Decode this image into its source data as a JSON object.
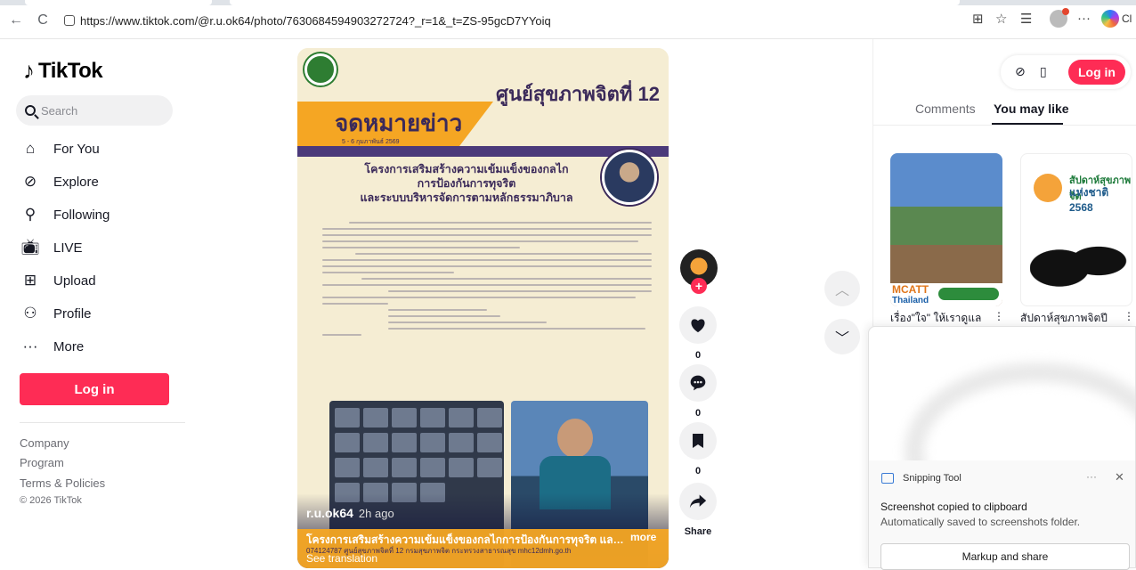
{
  "browser": {
    "back_glyph": "←",
    "reload_glyph": "C",
    "url": "https://www.tiktok.com/@r.u.ok64/photo/7630684594903272724?_r=1&_t=ZS-95gcD7YYoiq",
    "truncated_label": "Cl",
    "icons": [
      "app-grid-icon",
      "favorite-star-icon",
      "favorites-list-icon",
      "profile-icon",
      "more-icon",
      "copilot-icon"
    ]
  },
  "sidebar": {
    "logo_text": "TikTok",
    "search_placeholder": "Search",
    "nav": [
      {
        "label": "For You",
        "icon": "home-icon"
      },
      {
        "label": "Explore",
        "icon": "compass-icon"
      },
      {
        "label": "Following",
        "icon": "following-icon"
      },
      {
        "label": "LIVE",
        "icon": "live-tv-icon"
      },
      {
        "label": "Upload",
        "icon": "upload-plus-icon"
      },
      {
        "label": "Profile",
        "icon": "profile-icon"
      },
      {
        "label": "More",
        "icon": "more-dots-icon"
      }
    ],
    "login_label": "Log in",
    "footer": [
      "Company",
      "Program",
      "Terms & Policies"
    ],
    "copyright": "© 2026 TikTok"
  },
  "post": {
    "center_name": "ศูนย์สุขภาพจิตที่ 12",
    "headline": "จดหมายข่าว",
    "date": "5 - 6 กุมภาพันธ์ 2569",
    "project_title_1": "โครงการเสริมสร้างความเข้มแข็งของกลไก",
    "project_title_2": "การป้องกันการทุจริต",
    "project_title_3": "และระบบบริหารจัดการตามหลักธรรมาภิบาล",
    "author": "r.u.ok64",
    "posted_ago": "2h ago",
    "caption": "โครงการเสริมสร้างความเข้มแข็งของกลไกการป้องกันการทุจริต และระบบ",
    "caption_more": "more",
    "caption_sub": "074124787 ศูนย์สุขภาพจิตที่ 12 กรมสุขภาพจิต กระทรวงสาธารณสุข mhc12dmh.go.th",
    "see_translation": "See translation"
  },
  "actions": {
    "like_count": "0",
    "comment_count": "0",
    "save_count": "0",
    "share_label": "Share"
  },
  "right_panel": {
    "login_label": "Log in",
    "tab_comments": "Comments",
    "tab_you_may_like": "You may like",
    "thumb1_badge_1": "MCATT",
    "thumb1_badge_2": "Thailand",
    "thumb1_caption": "เรื่อง\"ใจ\" ให้เราดูแล",
    "thumb2_head_1": "สัปดาห์สุขภาพจิต",
    "thumb2_head_2": "แห่งชาติ 2568",
    "thumb2_caption": "สัปดาห์สุขภาพจิตปี"
  },
  "toast": {
    "app_name": "Snipping Tool",
    "more_glyph": "···",
    "close_glyph": "✕",
    "title": "Screenshot copied to clipboard",
    "subtitle": "Automatically saved to screenshots folder.",
    "button_label": "Markup and share"
  },
  "colors": {
    "brand": "#fe2c55",
    "post_background": "#f5edd3",
    "accent_orange": "#f5a623",
    "accent_purple": "#3b2a5a"
  }
}
